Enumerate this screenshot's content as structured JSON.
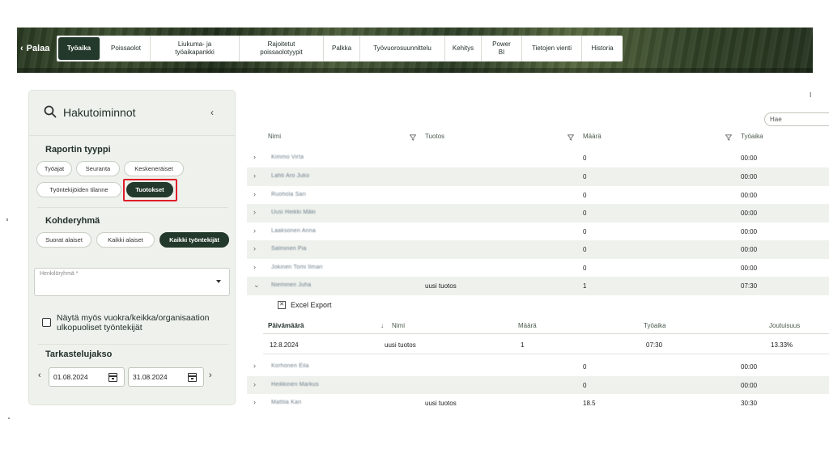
{
  "nav": {
    "back_label": "Palaa",
    "tabs": [
      {
        "label": "Työaika",
        "active": true
      },
      {
        "label": "Poissaolot"
      },
      {
        "label": "Liukuma- ja työaikapankki"
      },
      {
        "label": "Rajoitetut poissaolotyypit"
      },
      {
        "label": "Palkka"
      },
      {
        "label": "Työvuorosuunnittelu"
      },
      {
        "label": "Kehitys"
      },
      {
        "label": "Power BI"
      },
      {
        "label": "Tietojen vienti"
      },
      {
        "label": "Historia"
      }
    ]
  },
  "sidebar": {
    "title": "Hakutoiminnot",
    "report_type": {
      "heading": "Raportin tyyppi",
      "options": [
        "Työajat",
        "Seuranta",
        "Keskeneräiset",
        "Työntekijöiden tilanne",
        "Tuotokset"
      ],
      "selected": "Tuotokset"
    },
    "target_group": {
      "heading": "Kohderyhmä",
      "options": [
        "Suorat alaiset",
        "Kaikki alaiset",
        "Kaikki työntekijät"
      ],
      "selected": "Kaikki työntekijät"
    },
    "person_group": {
      "label": "Henkilöryhmä *",
      "value": ""
    },
    "external_checkbox": {
      "label": "Näytä myös vuokra/keikka/organisaation ulkopuoliset työntekijät",
      "checked": false
    },
    "period": {
      "heading": "Tarkastelujakso",
      "start": "01.08.2024",
      "end": "31.08.2024"
    }
  },
  "main": {
    "top_marker": "I",
    "search_placeholder": "Hae",
    "columns": [
      "Nimi",
      "Tuotos",
      "Määrä",
      "Työaika"
    ],
    "rows": [
      {
        "name": "Kimmo Virta",
        "tuotos": "",
        "maara": "0",
        "tyoaika": "00:00",
        "expanded": false
      },
      {
        "name": "Lahti Aro Juko",
        "tuotos": "",
        "maara": "0",
        "tyoaika": "00:00",
        "expanded": false
      },
      {
        "name": "Ruohola Sari",
        "tuotos": "",
        "maara": "0",
        "tyoaika": "00:00",
        "expanded": false
      },
      {
        "name": "Uusi Heikki Mäki",
        "tuotos": "",
        "maara": "0",
        "tyoaika": "00:00",
        "expanded": false
      },
      {
        "name": "Laaksonen Anna",
        "tuotos": "",
        "maara": "0",
        "tyoaika": "00:00",
        "expanded": false
      },
      {
        "name": "Salminen Pia",
        "tuotos": "",
        "maara": "0",
        "tyoaika": "00:00",
        "expanded": false
      },
      {
        "name": "Jokinen Tomi Ilmari",
        "tuotos": "",
        "maara": "0",
        "tyoaika": "00:00",
        "expanded": false
      },
      {
        "name": "Nieminen Juha",
        "tuotos": "uusi tuotos",
        "maara": "1",
        "tyoaika": "07:30",
        "expanded": true
      },
      {
        "name": "Korhonen Eila",
        "tuotos": "",
        "maara": "0",
        "tyoaika": "00:00",
        "expanded": false
      },
      {
        "name": "Heikkinen Markus",
        "tuotos": "",
        "maara": "0",
        "tyoaika": "00:00",
        "expanded": false
      },
      {
        "name": "Mattila Kari",
        "tuotos": "uusi tuotos",
        "maara": "18.5",
        "tyoaika": "30:30",
        "expanded": false
      }
    ],
    "excel_label": "Excel Export",
    "detail": {
      "columns": [
        "Päivämäärä",
        "Nimi",
        "Määrä",
        "Työaika",
        "Joutuisuus"
      ],
      "row": {
        "date": "12.8.2024",
        "name": "uusi tuotos",
        "maara": "1",
        "tyoaika": "07:30",
        "joutuisuus": "13.33%"
      }
    }
  }
}
